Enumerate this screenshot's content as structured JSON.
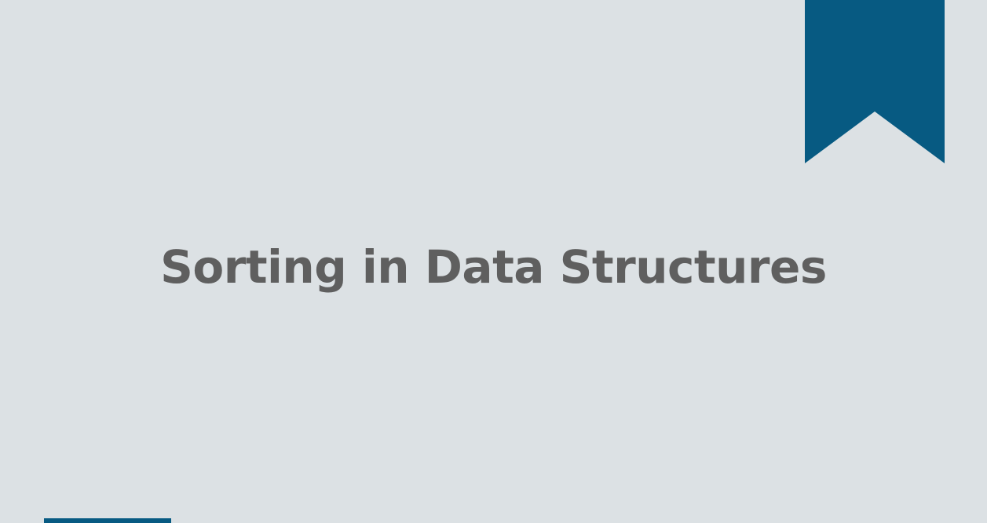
{
  "slide": {
    "title": "Sorting in Data Structures"
  },
  "colors": {
    "background": "#dce1e4",
    "accent": "#075a82",
    "title_text": "#5f5f5f"
  },
  "icons": {
    "corner_decoration": "bookmark-ribbon-icon"
  }
}
